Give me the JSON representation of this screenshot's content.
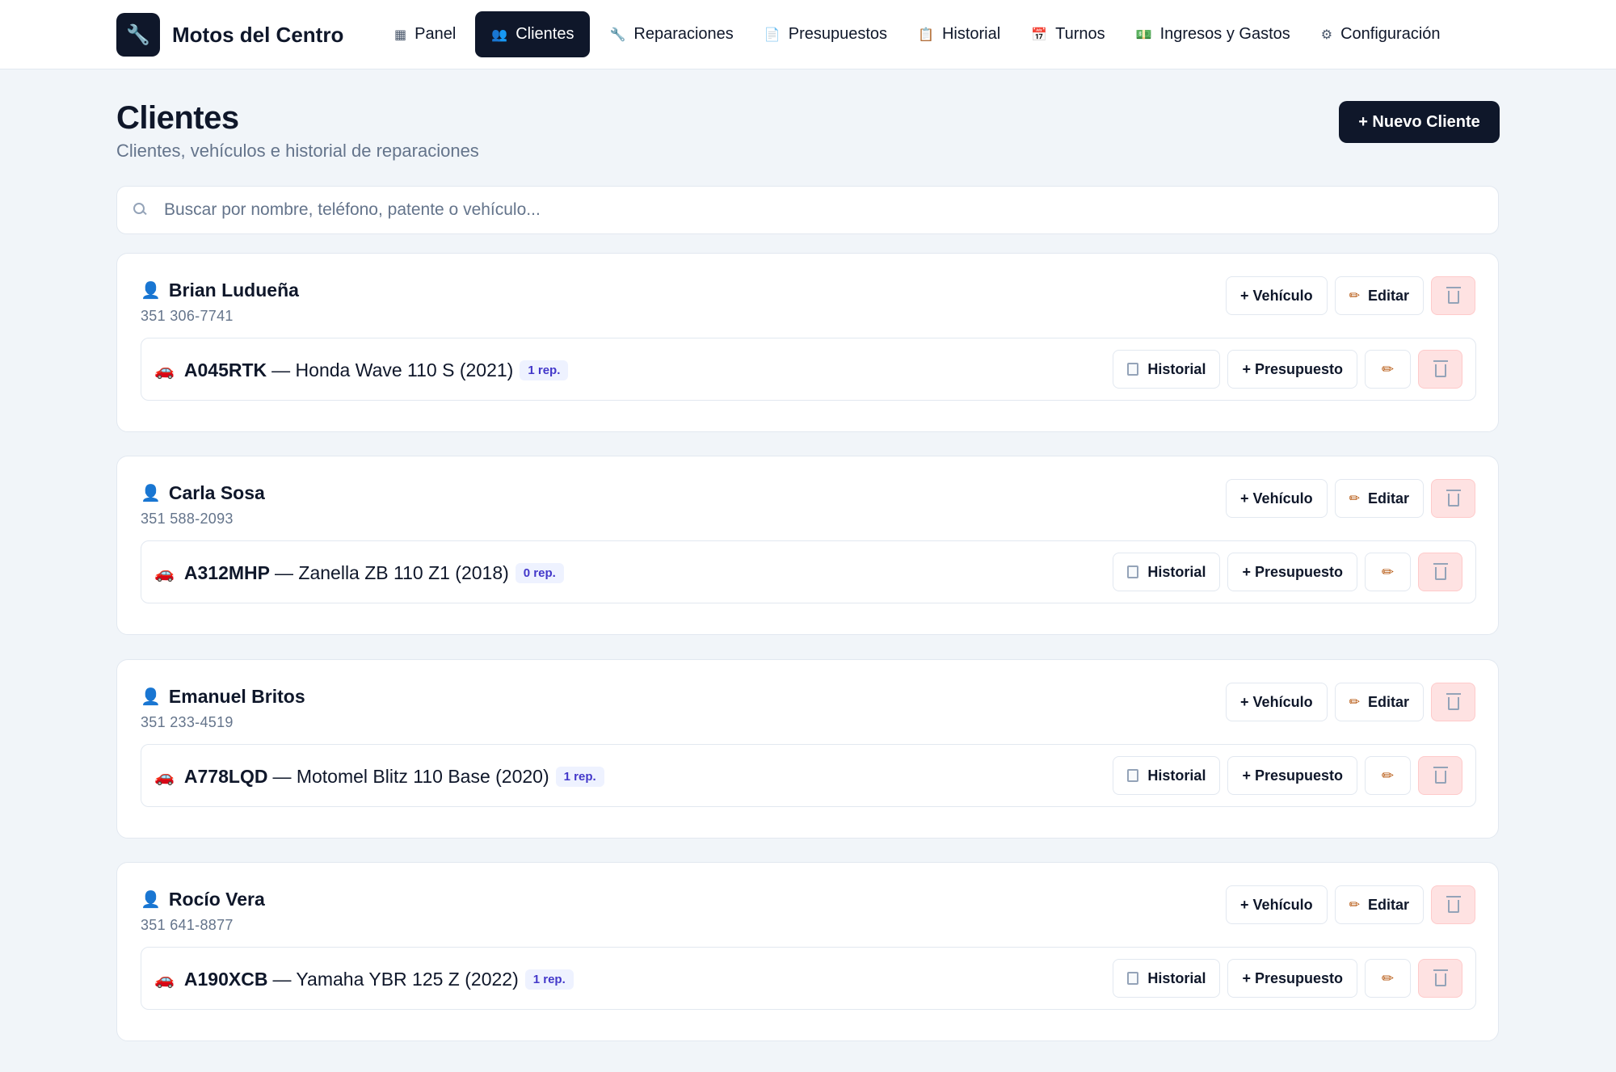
{
  "brand": {
    "name": "Motos del Centro",
    "logo_icon": "wrench-icon"
  },
  "nav": [
    {
      "label": "Panel",
      "icon": "dashboard-icon",
      "glyph": "▦",
      "active": false
    },
    {
      "label": "Clientes",
      "icon": "users-icon",
      "glyph": "👥",
      "active": true
    },
    {
      "label": "Reparaciones",
      "icon": "wrench-icon",
      "glyph": "🔧",
      "active": false
    },
    {
      "label": "Presupuestos",
      "icon": "document-icon",
      "glyph": "📄",
      "active": false
    },
    {
      "label": "Historial",
      "icon": "clipboard-icon",
      "glyph": "📋",
      "active": false
    },
    {
      "label": "Turnos",
      "icon": "calendar-icon",
      "glyph": "📅",
      "active": false
    },
    {
      "label": "Ingresos y Gastos",
      "icon": "money-icon",
      "glyph": "💵",
      "active": false
    },
    {
      "label": "Configuración",
      "icon": "gear-icon",
      "glyph": "⚙",
      "active": false
    }
  ],
  "page": {
    "title": "Clientes",
    "subtitle": "Clientes, vehículos e historial de reparaciones",
    "new_client_label": "+ Nuevo Cliente"
  },
  "search": {
    "placeholder": "Buscar por nombre, teléfono, patente o vehículo...",
    "value": ""
  },
  "labels": {
    "add_vehicle": "+ Vehículo",
    "edit": "Editar",
    "history": "Historial",
    "add_budget": "+ Presupuesto"
  },
  "clients": [
    {
      "name": "Brian Ludueña",
      "phone": "351 306-7741",
      "vehicle": {
        "plate": "A045RTK",
        "desc": "— Honda Wave 110 S (2021)",
        "reps": "1 rep."
      }
    },
    {
      "name": "Carla Sosa",
      "phone": "351 588-2093",
      "vehicle": {
        "plate": "A312MHP",
        "desc": "— Zanella ZB 110 Z1 (2018)",
        "reps": "0 rep."
      }
    },
    {
      "name": "Emanuel Britos",
      "phone": "351 233-4519",
      "vehicle": {
        "plate": "A778LQD",
        "desc": "— Motomel Blitz 110 Base (2020)",
        "reps": "1 rep."
      }
    },
    {
      "name": "Rocío Vera",
      "phone": "351 641-8877",
      "vehicle": {
        "plate": "A190XCB",
        "desc": "— Yamaha YBR 125 Z (2022)",
        "reps": "1 rep."
      }
    }
  ],
  "colors": {
    "primary": "#0f172a",
    "background": "#f1f5f9",
    "danger_bg": "#fee2e2",
    "badge_bg": "#eef2ff",
    "badge_text": "#4338ca"
  }
}
